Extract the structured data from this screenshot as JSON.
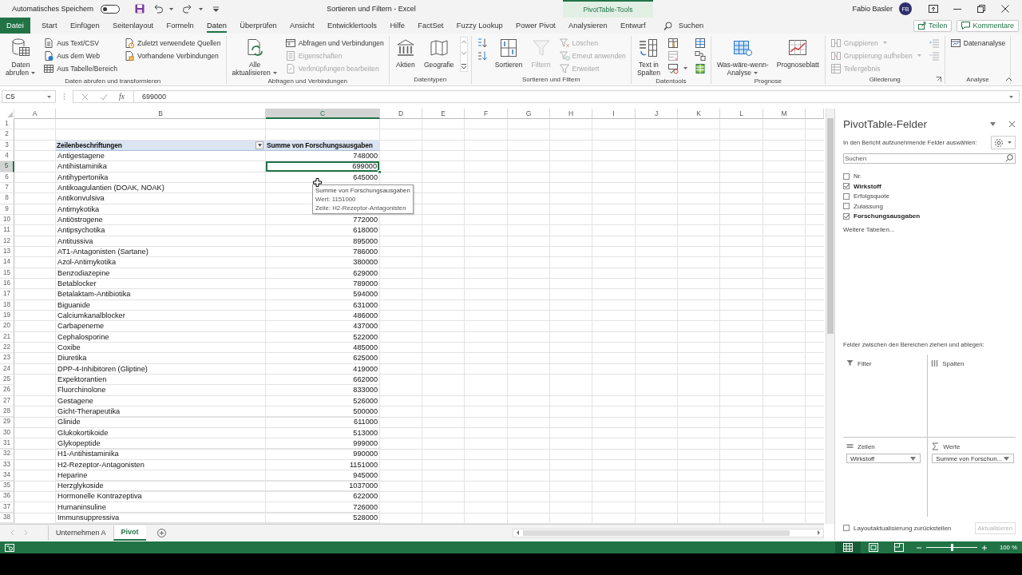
{
  "title_bar": {
    "autosave_label": "Automatisches Speichern",
    "autosave_on": false,
    "document_title": "Sortieren und Filtern  -  Excel",
    "context_tab": "PivotTable-Tools",
    "user_name": "Fabio Basler",
    "user_initials": "FB"
  },
  "ribbon_tabs": [
    {
      "label": "Datei",
      "kind": "file",
      "selected": false
    },
    {
      "label": "Start",
      "kind": "tab",
      "selected": false
    },
    {
      "label": "Einfügen",
      "kind": "tab",
      "selected": false
    },
    {
      "label": "Seitenlayout",
      "kind": "tab",
      "selected": false
    },
    {
      "label": "Formeln",
      "kind": "tab",
      "selected": false
    },
    {
      "label": "Daten",
      "kind": "tab",
      "selected": true
    },
    {
      "label": "Überprüfen",
      "kind": "tab",
      "selected": false
    },
    {
      "label": "Ansicht",
      "kind": "tab",
      "selected": false
    },
    {
      "label": "Entwicklertools",
      "kind": "tab",
      "selected": false
    },
    {
      "label": "Hilfe",
      "kind": "tab",
      "selected": false
    },
    {
      "label": "FactSet",
      "kind": "tab",
      "selected": false
    },
    {
      "label": "Fuzzy Lookup",
      "kind": "tab",
      "selected": false
    },
    {
      "label": "Power Pivot",
      "kind": "tab",
      "selected": false
    },
    {
      "label": "Analysieren",
      "kind": "tab",
      "selected": false
    },
    {
      "label": "Entwurf",
      "kind": "tab",
      "selected": false
    }
  ],
  "tell_me": {
    "label": "Suchen"
  },
  "share_button": "Teilen",
  "comments_button": "Kommentare",
  "ribbon_groups": [
    {
      "label": "Daten abrufen und transformieren",
      "items": [
        {
          "kind": "large",
          "label": "Daten\nabrufen",
          "menu": true,
          "disabled": false
        },
        {
          "kind": "stack",
          "buttons": [
            {
              "label": "Aus Text/CSV",
              "disabled": false
            },
            {
              "label": "Aus dem Web",
              "disabled": false
            },
            {
              "label": "Aus Tabelle/Bereich",
              "disabled": false
            }
          ]
        },
        {
          "kind": "stack",
          "buttons": [
            {
              "label": "Zuletzt verwendete Quellen",
              "disabled": false
            },
            {
              "label": "Vorhandene Verbindungen",
              "disabled": false
            }
          ]
        }
      ]
    },
    {
      "label": "Abfragen und Verbindungen",
      "items": [
        {
          "kind": "large",
          "label": "Alle\naktualisieren",
          "menu": true,
          "disabled": false
        },
        {
          "kind": "stack",
          "buttons": [
            {
              "label": "Abfragen und Verbindungen",
              "disabled": false
            },
            {
              "label": "Eigenschaften",
              "disabled": true
            },
            {
              "label": "Verknüpfungen bearbeiten",
              "disabled": true
            }
          ]
        }
      ]
    },
    {
      "label": "Datentypen",
      "items": [
        {
          "kind": "large",
          "label": "Aktien",
          "disabled": false
        },
        {
          "kind": "large",
          "label": "Geografie",
          "disabled": false
        },
        {
          "kind": "gallery_scroll"
        }
      ]
    },
    {
      "label": "Sortieren und Filtern",
      "items": [
        {
          "kind": "icon_stack",
          "buttons": [
            {
              "disabled": false
            },
            {
              "disabled": false
            }
          ]
        },
        {
          "kind": "large",
          "label": "Sortieren",
          "disabled": false
        },
        {
          "kind": "large",
          "label": "Filtern",
          "disabled": true
        },
        {
          "kind": "stack",
          "buttons": [
            {
              "label": "Löschen",
              "disabled": true
            },
            {
              "label": "Erneut anwenden",
              "disabled": true
            },
            {
              "label": "Erweitert",
              "disabled": true
            }
          ]
        }
      ]
    },
    {
      "label": "Datentools",
      "items": [
        {
          "kind": "large",
          "label": "Text in\nSpalten",
          "disabled": false
        },
        {
          "kind": "icon_stack",
          "buttons": [
            {
              "disabled": false
            },
            {
              "disabled": true
            },
            {
              "disabled": false,
              "menu": true
            }
          ]
        },
        {
          "kind": "icon_stack",
          "buttons": [
            {
              "disabled": false
            },
            {
              "disabled": false
            },
            {
              "disabled": false
            }
          ]
        }
      ]
    },
    {
      "label": "Prognose",
      "items": [
        {
          "kind": "large",
          "label": "Was-wäre-wenn-\nAnalyse",
          "menu": true,
          "disabled": false
        },
        {
          "kind": "large",
          "label": "Prognoseblatt",
          "disabled": false
        }
      ]
    },
    {
      "label": "Gliederung",
      "launcher": true,
      "items": [
        {
          "kind": "stack",
          "buttons": [
            {
              "label": "Gruppieren",
              "disabled": true,
              "menu": true
            },
            {
              "label": "Gruppierung aufheben",
              "disabled": true,
              "menu": true
            },
            {
              "label": "Teilergebnis",
              "disabled": true
            }
          ]
        },
        {
          "kind": "icon_stack",
          "buttons": [
            {
              "disabled": true
            },
            {
              "disabled": true
            }
          ]
        }
      ]
    },
    {
      "label": "Analyse",
      "items": [
        {
          "kind": "stack",
          "buttons": [
            {
              "label": "Datenanalyse",
              "disabled": false
            }
          ]
        }
      ]
    }
  ],
  "formula_bar": {
    "name_box": "C5",
    "function_label": "fx",
    "formula": "699000"
  },
  "sheet": {
    "columns": [
      {
        "label": "A",
        "selected": false
      },
      {
        "label": "B",
        "selected": false
      },
      {
        "label": "C",
        "selected": true
      },
      {
        "label": "D",
        "selected": false
      },
      {
        "label": "E",
        "selected": false
      },
      {
        "label": "F",
        "selected": false
      },
      {
        "label": "G",
        "selected": false
      },
      {
        "label": "H",
        "selected": false
      },
      {
        "label": "I",
        "selected": false
      },
      {
        "label": "J",
        "selected": false
      },
      {
        "label": "K",
        "selected": false
      },
      {
        "label": "L",
        "selected": false
      },
      {
        "label": "M",
        "selected": false
      }
    ],
    "rows": [
      {
        "number": "1",
        "kind": "empty",
        "selected": false
      },
      {
        "number": "2",
        "kind": "empty",
        "selected": false
      },
      {
        "number": "3",
        "kind": "header",
        "selected": false,
        "label": "Zeilenbeschriftungen",
        "value": "Summe von Forschungsausgaben"
      },
      {
        "number": "4",
        "kind": "item",
        "selected": false,
        "label": "Antigestagene",
        "value": "748000"
      },
      {
        "number": "5",
        "kind": "item",
        "selected": true,
        "label": "Antihistaminika",
        "value": "699000"
      },
      {
        "number": "6",
        "kind": "item",
        "selected": false,
        "label": "Antihypertonika",
        "value": "645000"
      },
      {
        "number": "7",
        "kind": "item",
        "selected": false,
        "label": "Antikoagulantien (DOAK, NOAK)"
      },
      {
        "number": "8",
        "kind": "item",
        "selected": false,
        "label": "Antikonvulsiva"
      },
      {
        "number": "9",
        "kind": "item",
        "selected": false,
        "label": "Antimykotika"
      },
      {
        "number": "10",
        "kind": "item",
        "selected": false,
        "label": "Antiöstrogene",
        "value": "772000"
      },
      {
        "number": "11",
        "kind": "item",
        "selected": false,
        "label": "Antipsychotika",
        "value": "618000"
      },
      {
        "number": "12",
        "kind": "item",
        "selected": false,
        "label": "Antitussiva",
        "value": "895000"
      },
      {
        "number": "13",
        "kind": "item",
        "selected": false,
        "label": "AT1-Antagonisten (Sartane)",
        "value": "786000"
      },
      {
        "number": "14",
        "kind": "item",
        "selected": false,
        "label": "Azol-Antimykotika",
        "value": "380000"
      },
      {
        "number": "15",
        "kind": "item",
        "selected": false,
        "label": "Benzodiazepine",
        "value": "629000"
      },
      {
        "number": "16",
        "kind": "item",
        "selected": false,
        "label": "Betablocker",
        "value": "789000"
      },
      {
        "number": "17",
        "kind": "item",
        "selected": false,
        "label": "Betalaktam-Antibiotika",
        "value": "594000"
      },
      {
        "number": "18",
        "kind": "item",
        "selected": false,
        "label": "Biguanide",
        "value": "631000"
      },
      {
        "number": "19",
        "kind": "item",
        "selected": false,
        "label": "Calciumkanalblocker",
        "value": "486000"
      },
      {
        "number": "20",
        "kind": "item",
        "selected": false,
        "label": "Carbapeneme",
        "value": "437000"
      },
      {
        "number": "21",
        "kind": "item",
        "selected": false,
        "label": "Cephalosporine",
        "value": "522000"
      },
      {
        "number": "22",
        "kind": "item",
        "selected": false,
        "label": "Coxibe",
        "value": "485000"
      },
      {
        "number": "23",
        "kind": "item",
        "selected": false,
        "label": "Diuretika",
        "value": "625000"
      },
      {
        "number": "24",
        "kind": "item",
        "selected": false,
        "label": "DPP-4-Inhibitoren (Gliptine)",
        "value": "419000"
      },
      {
        "number": "25",
        "kind": "item",
        "selected": false,
        "label": "Expektorantien",
        "value": "662000"
      },
      {
        "number": "26",
        "kind": "item",
        "selected": false,
        "label": "Fluorchinolone",
        "value": "833000"
      },
      {
        "number": "27",
        "kind": "item",
        "selected": false,
        "label": "Gestagene",
        "value": "526000"
      },
      {
        "number": "28",
        "kind": "item",
        "selected": false,
        "label": "Gicht-Therapeutika",
        "value": "500000"
      },
      {
        "number": "29",
        "kind": "item",
        "selected": false,
        "label": "Glinide",
        "value": "611000"
      },
      {
        "number": "30",
        "kind": "item",
        "selected": false,
        "label": "Glukokortikoide",
        "value": "513000"
      },
      {
        "number": "31",
        "kind": "item",
        "selected": false,
        "label": "Glykopeptide",
        "value": "999000"
      },
      {
        "number": "32",
        "kind": "item",
        "selected": false,
        "label": "H1-Antihistaminika",
        "value": "990000"
      },
      {
        "number": "33",
        "kind": "item",
        "selected": false,
        "label": "H2-Rezeptor-Antagonisten",
        "value": "1151000"
      },
      {
        "number": "34",
        "kind": "item",
        "selected": false,
        "label": "Heparine",
        "value": "945000"
      },
      {
        "number": "35",
        "kind": "item",
        "selected": false,
        "label": "Herzglykoside",
        "value": "1037000"
      },
      {
        "number": "36",
        "kind": "item",
        "selected": false,
        "label": "Hormonelle Kontrazeptiva",
        "value": "622000"
      },
      {
        "number": "37",
        "kind": "item",
        "selected": false,
        "label": "Humaninsuline",
        "value": "726000"
      },
      {
        "number": "38",
        "kind": "item",
        "selected": false,
        "label": "Immunsuppressiva",
        "value": "528000"
      }
    ]
  },
  "tooltip": {
    "title": "Summe von Forschungsausgaben",
    "lines": [
      "Wert: 1151000",
      "Zeile: H2-Rezeptor-Antagonisten"
    ]
  },
  "sheet_tabs": [
    {
      "label": "Unternehmen A",
      "selected": false
    },
    {
      "label": "Pivot",
      "selected": true
    }
  ],
  "pivot_panel": {
    "title": "PivotTable-Felder",
    "prompt": "In den Bericht aufzunehmende Felder auswählen:",
    "search": {
      "placeholder": "Suchen"
    },
    "fields": [
      {
        "label": "Nr.",
        "checked": false
      },
      {
        "label": "Wirkstoff",
        "checked": true
      },
      {
        "label": "Erfolgsquote",
        "checked": false
      },
      {
        "label": "Zulassung",
        "checked": false
      },
      {
        "label": "Forschungsausgaben",
        "checked": true
      }
    ],
    "more_tables": "Weitere Tabellen...",
    "areas_prompt": "Felder zwischen den Bereichen ziehen und ablegen:",
    "areas": [
      {
        "kind": "filter",
        "label": "Filter"
      },
      {
        "kind": "columns",
        "label": "Spalten"
      },
      {
        "kind": "rows",
        "label": "Zeilen",
        "items": [
          "Wirkstoff"
        ]
      },
      {
        "kind": "values",
        "label": "Werte",
        "items": [
          "Summe von Forschun..."
        ]
      }
    ],
    "defer": {
      "label": "Layoutaktualisierung zurückstellen",
      "checked": false
    },
    "update_button": {
      "label": "Aktualisieren",
      "disabled": true
    }
  },
  "status_bar": {
    "views": [
      {
        "kind": "normal",
        "selected": true
      },
      {
        "kind": "layout",
        "selected": false
      },
      {
        "kind": "pagebreak",
        "selected": false
      }
    ],
    "zoom": {
      "level": 0.5,
      "reading": "100 %"
    }
  }
}
